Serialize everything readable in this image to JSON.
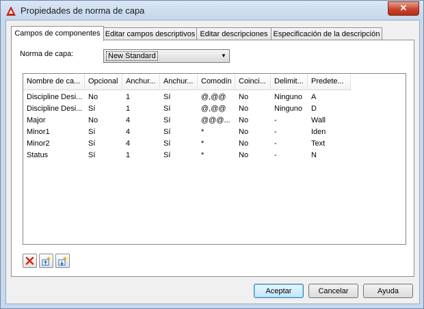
{
  "window": {
    "title": "Propiedades de norma de capa",
    "close_glyph": "✕"
  },
  "tabs": [
    {
      "label": "Campos de componentes",
      "active": true
    },
    {
      "label": "Editar campos descriptivos",
      "active": false
    },
    {
      "label": "Editar descripciones",
      "active": false
    },
    {
      "label": "Especificación de la descripción",
      "active": false
    }
  ],
  "norma": {
    "label": "Norma de capa:",
    "value": "New Standard",
    "arrow_glyph": "▼"
  },
  "table": {
    "headers": [
      "Nombre de ca...",
      "Opcional",
      "Anchur...",
      "Anchur...",
      "Comodín",
      "Coinci...",
      "Delimit...",
      "Predete..."
    ],
    "rows": [
      [
        "Discipline Desi...",
        "No",
        "1",
        "Sí",
        "@,@@",
        "No",
        "Ninguno",
        "A"
      ],
      [
        "Discipline Desi...",
        "Sí",
        "1",
        "Sí",
        "@,@@",
        "No",
        "Ninguno",
        "D"
      ],
      [
        "Major",
        "No",
        "4",
        "Sí",
        "@@@...",
        "No",
        "-",
        "Wall"
      ],
      [
        "Minor1",
        "Sí",
        "4",
        "Sí",
        "*",
        "No",
        "-",
        "Iden"
      ],
      [
        "Minor2",
        "Sí",
        "4",
        "Sí",
        "*",
        "No",
        "-",
        "Text"
      ],
      [
        "Status",
        "Sí",
        "1",
        "Sí",
        "*",
        "No",
        "-",
        "N"
      ]
    ]
  },
  "toolbar": {
    "icons": [
      "delete-icon",
      "move-up-icon",
      "move-down-icon"
    ]
  },
  "buttons": {
    "ok": "Aceptar",
    "cancel": "Cancelar",
    "help": "Ayuda"
  },
  "colors": {
    "title_bar": "#c5d7ec",
    "close_button": "#c8452d",
    "default_button": "#bee6fd",
    "delete_icon": "#d4281d",
    "arrow_icon": "#2a6cc4",
    "star_icon": "#f0b400"
  }
}
